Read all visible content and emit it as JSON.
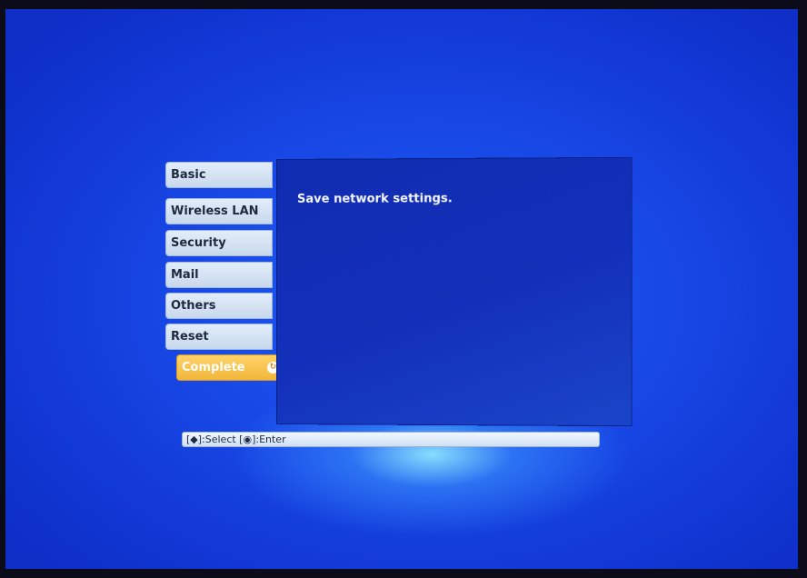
{
  "menu": {
    "items": [
      {
        "label": "Basic"
      },
      {
        "label": "Wireless LAN"
      },
      {
        "label": "Security"
      },
      {
        "label": "Mail"
      },
      {
        "label": "Others"
      },
      {
        "label": "Reset"
      },
      {
        "label": "Complete",
        "selected": true
      }
    ]
  },
  "content": {
    "message": "Save network settings."
  },
  "help_bar": {
    "text": "[◆]:Select  [◉]:Enter"
  },
  "icons": {
    "enter": "enter-icon"
  },
  "colors": {
    "background": "#1848e6",
    "panel": "#1330ba",
    "tab": "#d6e4f4",
    "tab_active": "#f1b63a"
  }
}
